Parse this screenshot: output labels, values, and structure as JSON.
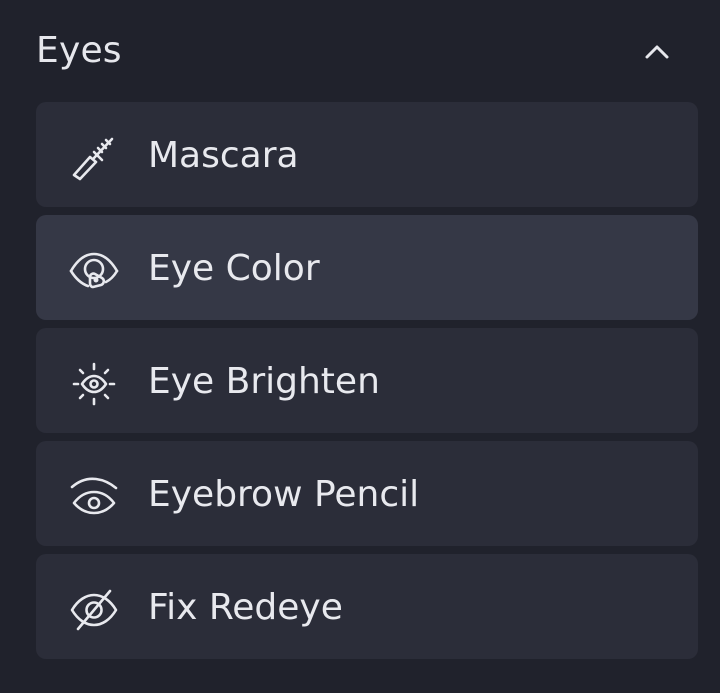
{
  "section": {
    "title": "Eyes",
    "expanded": true,
    "collapse_icon": "chevron-up-icon"
  },
  "items": [
    {
      "label": "Mascara",
      "icon": "mascara-brush-icon",
      "selected": false
    },
    {
      "label": "Eye Color",
      "icon": "eye-color-palette-icon",
      "selected": true
    },
    {
      "label": "Eye Brighten",
      "icon": "eye-sparkle-icon",
      "selected": false
    },
    {
      "label": "Eyebrow Pencil",
      "icon": "eyebrow-eye-icon",
      "selected": false
    },
    {
      "label": "Fix Redeye",
      "icon": "eye-slash-icon",
      "selected": false
    }
  ],
  "colors": {
    "background": "#20222c",
    "item_background": "#2b2d39",
    "item_selected_background": "#353846",
    "text": "#e8e9ee"
  }
}
